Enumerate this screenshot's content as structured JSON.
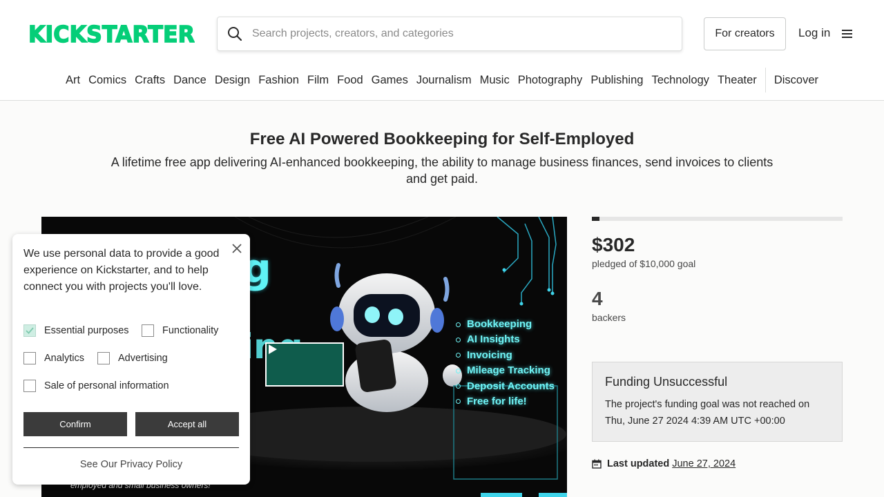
{
  "header": {
    "logo_text": "KICKSTARTER",
    "search_placeholder": "Search projects, creators, and categories",
    "for_creators": "For creators",
    "login": "Log in",
    "categories": [
      "Art",
      "Comics",
      "Crafts",
      "Dance",
      "Design",
      "Fashion",
      "Film",
      "Food",
      "Games",
      "Journalism",
      "Music",
      "Photography",
      "Publishing",
      "Technology",
      "Theater"
    ],
    "discover": "Discover"
  },
  "project": {
    "title": "Free AI Powered Bookkeeping for Self-Employed",
    "subtitle": "A lifetime free app delivering AI-enhanced bookkeeping, the ability to manage business finances, send invoices to clients and get paid.",
    "video": {
      "features": [
        "Bookkeeping",
        "AI Insights",
        "Invoicing",
        "Mileage Tracking",
        "Deposit Accounts",
        "Free for life!"
      ],
      "tagline": "employed and small business owners!"
    }
  },
  "stats": {
    "progress_fraction": 0.0302,
    "pledged": "$302",
    "pledged_label": "pledged of $10,000 goal",
    "backers": "4",
    "backers_label": "backers"
  },
  "funding": {
    "heading": "Funding Unsuccessful",
    "message": "The project's funding goal was not reached on Thu, June 27 2024 4:39 AM UTC +00:00"
  },
  "updated": {
    "label": "Last updated",
    "date": "June 27, 2024"
  },
  "cookie": {
    "message": "We use personal data to provide a good experience on Kickstarter, and to help connect you with projects you'll love.",
    "options": {
      "essential": "Essential purposes",
      "functionality": "Functionality",
      "analytics": "Analytics",
      "advertising": "Advertising",
      "sale": "Sale of personal information"
    },
    "confirm": "Confirm",
    "accept_all": "Accept all",
    "policy": "See Our Privacy Policy"
  },
  "colors": {
    "brand": "#05ce78",
    "cyan_text": "#6ff3f5",
    "play_button": "#0f5c4c"
  }
}
